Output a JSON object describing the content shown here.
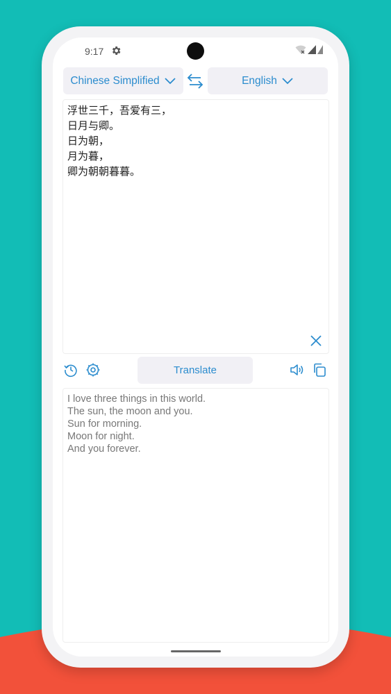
{
  "status_bar": {
    "time": "9:17",
    "icons": [
      "gear-icon",
      "wifi-icon",
      "signal-icon",
      "signal-icon"
    ]
  },
  "languages": {
    "source": "Chinese Simplified",
    "target": "English",
    "swap_icon": "swap-icon"
  },
  "input": {
    "text": "浮世三千，吾爱有三，\n日月与卿。\n日为朝，\n月为暮，\n卿为朝朝暮暮。",
    "clear_icon": "close-icon"
  },
  "toolbar": {
    "history_icon": "history-icon",
    "settings_icon": "settings-icon",
    "translate_label": "Translate",
    "speaker_icon": "speaker-icon",
    "copy_icon": "copy-icon"
  },
  "output": {
    "text": "I love three things in this world.\nThe sun, the moon and you.\nSun for morning.\nMoon for night.\nAnd you forever."
  },
  "colors": {
    "accent": "#2b8cce",
    "background_teal": "#12bdb6",
    "background_red": "#f2513a"
  }
}
